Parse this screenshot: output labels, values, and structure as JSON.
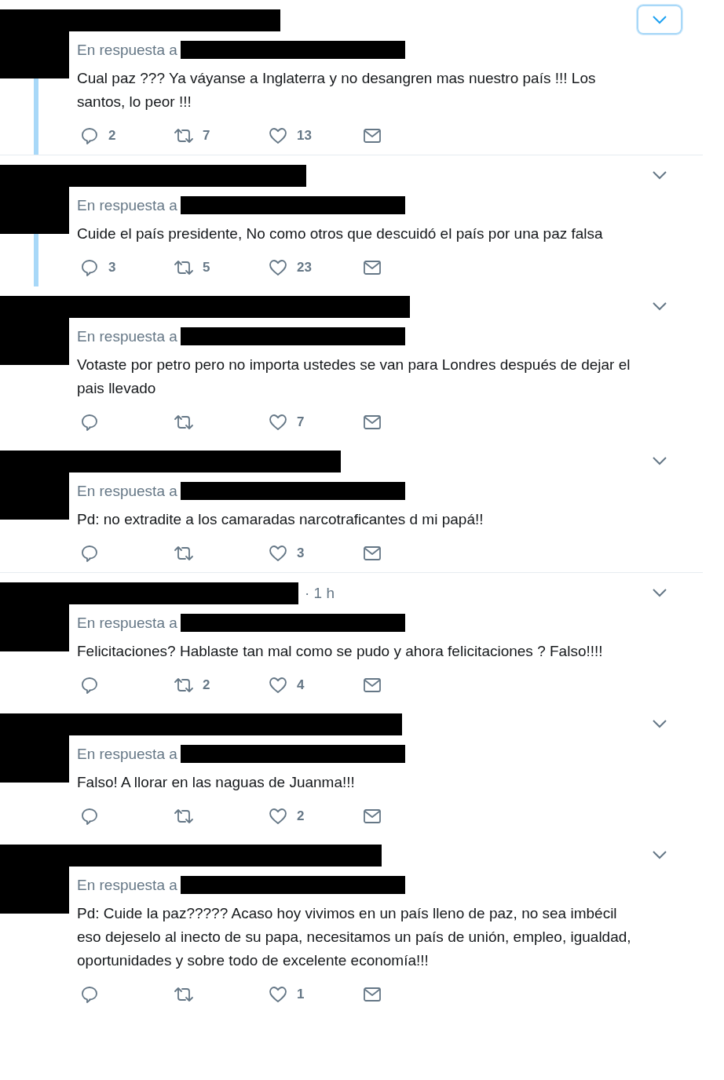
{
  "tweets": [
    {
      "reply_prefix": "En respuesta a",
      "text": "Cual paz ??? Ya váyanse a Inglaterra y no desangren mas nuestro país !!! Los santos, lo peor !!!",
      "replies": "2",
      "retweets": "7",
      "likes": "13",
      "thread": true,
      "separated": true,
      "menu_focused": true
    },
    {
      "reply_prefix": "En respuesta a",
      "text": "Cuide el país presidente, No como otros que descuidó el país por una paz falsa",
      "replies": "3",
      "retweets": "5",
      "likes": "23",
      "thread": true,
      "separated": false,
      "menu_focused": false
    },
    {
      "reply_prefix": "En respuesta a",
      "text": "Votaste por petro pero no importa ustedes se van para Londres después de dejar el pais llevado",
      "likes": "7",
      "thread": false,
      "separated": false,
      "menu_focused": false
    },
    {
      "reply_prefix": "En respuesta a",
      "text": "Pd: no extradite a los camaradas narcotraficantes d mi papá!!",
      "likes": "3",
      "thread": false,
      "separated": true,
      "menu_focused": false
    },
    {
      "time": "· 1 h",
      "reply_prefix": "En respuesta a",
      "text": "Felicitaciones? Hablaste tan mal como se pudo y ahora felicitaciones ? Falso!!!!",
      "retweets": "2",
      "likes": "4",
      "thread": false,
      "separated": false,
      "menu_focused": false
    },
    {
      "reply_prefix": "En respuesta a",
      "text": "Falso! A llorar en las naguas de Juanma!!!",
      "likes": "2",
      "thread": false,
      "separated": false,
      "menu_focused": false
    },
    {
      "reply_prefix": "En respuesta a",
      "text": "Pd: Cuide la paz????? Acaso hoy vivimos en un país lleno de paz, no sea imbécil eso dejeselo al inecto de su papa, necesitamos un país de unión, empleo, igualdad, oportunidades y sobre todo de excelente economía!!!",
      "likes": "1",
      "thread": false,
      "separated": false,
      "menu_focused": false
    }
  ]
}
